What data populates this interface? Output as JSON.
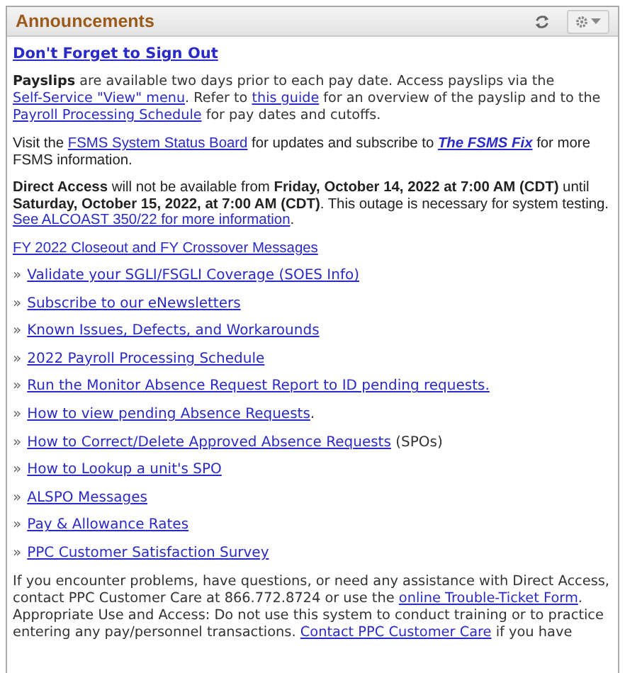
{
  "panel": {
    "title": "Announcements",
    "blocks": [
      {
        "kind": "heading-link",
        "segments": [
          {
            "kind": "link",
            "text": "Don't Forget to Sign Out"
          }
        ]
      },
      {
        "kind": "paragraph",
        "segments": [
          {
            "kind": "bold",
            "text": "Payslips"
          },
          {
            "kind": "text",
            "text": " are available two days prior to each pay date.  Access payslips via the "
          },
          {
            "kind": "link",
            "text": "Self-Service \"View\" menu"
          },
          {
            "kind": "text",
            "text": ".  Refer to "
          },
          {
            "kind": "link",
            "text": "this guide"
          },
          {
            "kind": "text",
            "text": " for an overview of the payslip and to the "
          },
          {
            "kind": "link",
            "text": "Payroll Processing Schedule"
          },
          {
            "kind": "text",
            "text": " for pay dates and cutoffs."
          }
        ]
      },
      {
        "kind": "notice",
        "segments": [
          {
            "kind": "text",
            "text": "Visit the  "
          },
          {
            "kind": "link",
            "text": "FSMS System Status Board"
          },
          {
            "kind": "text",
            "text": " for updates and subscribe to "
          },
          {
            "kind": "bold-italic-link",
            "text": "The FSMS Fix"
          },
          {
            "kind": "text",
            "text": " for more FSMS information."
          }
        ]
      },
      {
        "kind": "notice",
        "segments": [
          {
            "kind": "bold",
            "text": "Direct Access"
          },
          {
            "kind": "text",
            "text": " will not be available from "
          },
          {
            "kind": "bold",
            "text": "Friday, October 14, 2022 at 7:00 AM (CDT)"
          },
          {
            "kind": "text",
            "text": " until "
          },
          {
            "kind": "bold",
            "text": "Saturday, October 15, 2022, at 7:00 AM (CDT)"
          },
          {
            "kind": "text",
            "text": ". This outage is necessary for system testing. "
          },
          {
            "kind": "link",
            "text": "See ALCOAST 350/22 for more information"
          },
          {
            "kind": "text",
            "text": "."
          }
        ]
      },
      {
        "kind": "notice-link",
        "segments": [
          {
            "kind": "link",
            "text": "FY 2022 Closeout and FY Crossover Messages"
          }
        ]
      },
      {
        "kind": "list-item",
        "bullet": "»",
        "segments": [
          {
            "kind": "link",
            "text": "Validate your SGLI/FSGLI Coverage (SOES Info)"
          }
        ]
      },
      {
        "kind": "list-item",
        "bullet": "»",
        "segments": [
          {
            "kind": "link",
            "text": "Subscribe to our eNewsletters"
          }
        ]
      },
      {
        "kind": "list-item",
        "bullet": "»",
        "segments": [
          {
            "kind": "link",
            "text": "Known Issues, Defects, and Workarounds"
          }
        ]
      },
      {
        "kind": "list-item",
        "bullet": "»",
        "segments": [
          {
            "kind": "link",
            "text": "2022 Payroll Processing Schedule "
          }
        ]
      },
      {
        "kind": "list-item",
        "bullet": "»",
        "segments": [
          {
            "kind": "link",
            "text": "Run the Monitor Absence Request Report to ID pending requests."
          }
        ]
      },
      {
        "kind": "list-item",
        "bullet": "»",
        "segments": [
          {
            "kind": "link",
            "text": "How to view pending Absence Requests"
          },
          {
            "kind": "text",
            "text": "."
          }
        ]
      },
      {
        "kind": "list-item",
        "bullet": "»",
        "segments": [
          {
            "kind": "link",
            "text": "How to Correct/Delete Approved Absence Requests"
          },
          {
            "kind": "text",
            "text": " (SPOs)"
          }
        ]
      },
      {
        "kind": "list-item",
        "bullet": "»",
        "segments": [
          {
            "kind": "link",
            "text": "How to Lookup a unit's SPO"
          }
        ]
      },
      {
        "kind": "list-item",
        "bullet": "»",
        "segments": [
          {
            "kind": "link",
            "text": "ALSPO Messages"
          }
        ]
      },
      {
        "kind": "list-item",
        "bullet": "»",
        "segments": [
          {
            "kind": "link",
            "text": "Pay & Allowance Rates"
          }
        ]
      },
      {
        "kind": "list-item",
        "bullet": "»",
        "segments": [
          {
            "kind": "link",
            "text": "PPC Customer Satisfaction Survey"
          }
        ]
      },
      {
        "kind": "footer",
        "segments": [
          {
            "kind": "text",
            "text": "If you encounter problems, have questions, or need any assistance with Direct Access, contact PPC Customer Care at 866.772.8724 or use the "
          },
          {
            "kind": "link",
            "text": "online Trouble-Ticket Form"
          },
          {
            "kind": "text",
            "text": ". Appropriate Use and Access: Do not use this system to conduct training or to practice entering any pay/personnel transactions. "
          },
          {
            "kind": "link",
            "text": "Contact PPC Customer Care"
          },
          {
            "kind": "text",
            "text": " if you have"
          }
        ]
      }
    ]
  }
}
